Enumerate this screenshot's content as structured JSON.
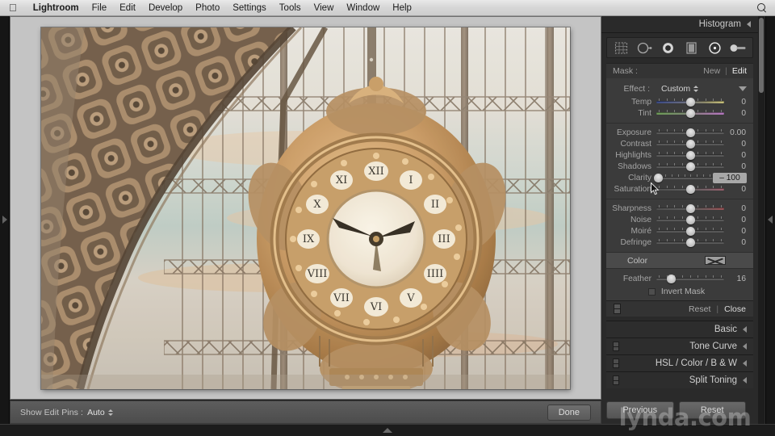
{
  "menubar": {
    "apple_logo": "apple-logo",
    "items": [
      "Lightroom",
      "File",
      "Edit",
      "Develop",
      "Photo",
      "Settings",
      "Tools",
      "View",
      "Window",
      "Help"
    ],
    "search_icon": "spotlight-search-icon"
  },
  "photo": {
    "alt": "Ornate gilded clock with Roman numerals at Musee d'Orsay, seen against a large arched glass-and-iron station window"
  },
  "toolbar": {
    "show_edit_pins_label": "Show Edit Pins :",
    "show_edit_pins_value": "Auto",
    "done_label": "Done"
  },
  "right_panel": {
    "histogram_title": "Histogram",
    "tools": [
      {
        "name": "crop-overlay-tool",
        "selected": false
      },
      {
        "name": "spot-removal-tool",
        "selected": false
      },
      {
        "name": "red-eye-correction-tool",
        "selected": false
      },
      {
        "name": "graduated-filter-tool",
        "selected": false
      },
      {
        "name": "radial-filter-tool",
        "selected": true
      },
      {
        "name": "adjustment-brush-tool",
        "selected": false
      }
    ],
    "mask": {
      "label": "Mask :",
      "new_label": "New",
      "separator": "|",
      "edit_label": "Edit"
    },
    "effect": {
      "label": "Effect :",
      "value": "Custom"
    },
    "sliders": [
      {
        "label": "Temp",
        "value": "0",
        "pos": 50,
        "gradient": "temp"
      },
      {
        "label": "Tint",
        "value": "0",
        "pos": 50,
        "gradient": "tint"
      },
      {
        "label": "Exposure",
        "value": "0.00",
        "pos": 50,
        "gradient": "none"
      },
      {
        "label": "Contrast",
        "value": "0",
        "pos": 50,
        "gradient": "none"
      },
      {
        "label": "Highlights",
        "value": "0",
        "pos": 50,
        "gradient": "none"
      },
      {
        "label": "Shadows",
        "value": "0",
        "pos": 50,
        "gradient": "none"
      },
      {
        "label": "Clarity",
        "value": "– 100",
        "pos": 3,
        "gradient": "none",
        "active": true
      },
      {
        "label": "Saturation",
        "value": "0",
        "pos": 50,
        "gradient": "sat"
      },
      {
        "label": "Sharpness",
        "value": "0",
        "pos": 50,
        "gradient": "sharp"
      },
      {
        "label": "Noise",
        "value": "0",
        "pos": 50,
        "gradient": "none"
      },
      {
        "label": "Moiré",
        "value": "0",
        "pos": 50,
        "gradient": "none"
      },
      {
        "label": "Defringe",
        "value": "0",
        "pos": 50,
        "gradient": "none"
      }
    ],
    "color_row": {
      "label": "Color",
      "swatch": "color-swatch-none"
    },
    "feather": {
      "label": "Feather",
      "value": "16",
      "pos": 22
    },
    "invert_mask": {
      "label": "Invert Mask",
      "checked": false
    },
    "reset_close": {
      "reset_label": "Reset",
      "separator": "|",
      "close_label": "Close"
    },
    "panels": [
      {
        "title": "Basic",
        "has_switch": false
      },
      {
        "title": "Tone Curve",
        "has_switch": true
      },
      {
        "title": "HSL / Color / B & W",
        "has_switch": true
      },
      {
        "title": "Split Toning",
        "has_switch": true
      }
    ],
    "previous_label": "Previous",
    "reset_label": "Reset"
  },
  "watermark": "lynda.com",
  "colors": {
    "panel_bg": "#2a2a2a",
    "slider_group_bg": "#3b3b3b",
    "canvas_bg": "#c4c4c4",
    "active_value_bg": "#a8a8a8",
    "menubar_bg": "#d6d6d6"
  }
}
